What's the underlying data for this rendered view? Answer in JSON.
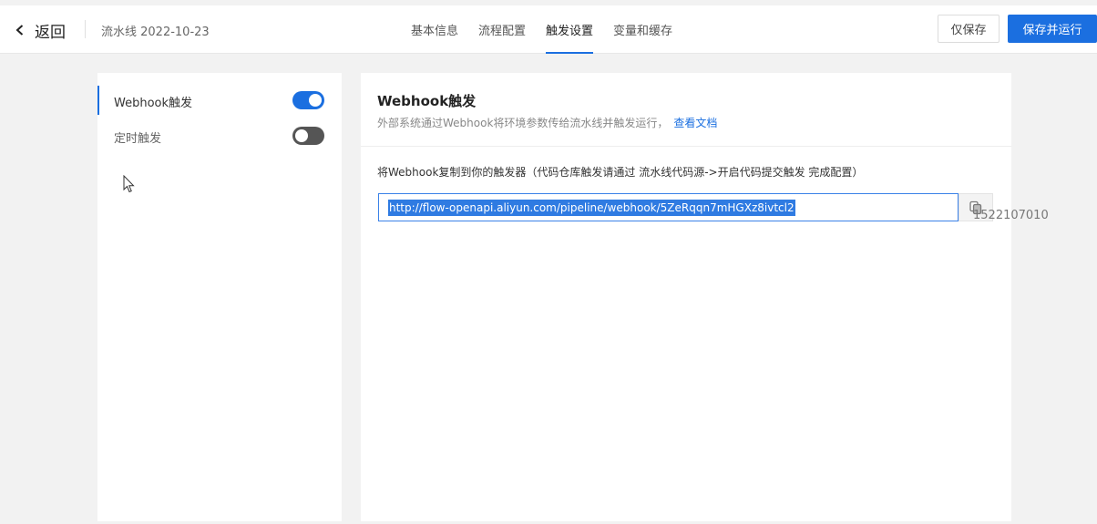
{
  "header": {
    "back_label": "返回",
    "pipeline_name": "流水线 2022-10-23",
    "tabs": [
      {
        "label": "基本信息",
        "active": false
      },
      {
        "label": "流程配置",
        "active": false
      },
      {
        "label": "触发设置",
        "active": true
      },
      {
        "label": "变量和缓存",
        "active": false
      }
    ],
    "save_label": "仅保存",
    "save_run_label": "保存并运行"
  },
  "sidebar": {
    "items": [
      {
        "label": "Webhook触发",
        "enabled": true,
        "active": true
      },
      {
        "label": "定时触发",
        "enabled": false,
        "active": false
      }
    ]
  },
  "webhook": {
    "title": "Webhook触发",
    "description": "外部系统通过Webhook将环境参数传给流水线并触发运行，",
    "doc_link": "查看文档",
    "instruction": "将Webhook复制到你的触发器（代码仓库触发请通过 流水线代码源->开启代码提交触发 完成配置）",
    "url": "http://flow-openapi.aliyun.com/pipeline/webhook/5ZeRqqn7mHGXz8ivtcl2",
    "copy_icon": "copy-icon"
  },
  "overlay": {
    "watermark": "1522107010"
  },
  "colors": {
    "accent": "#1b6fe0",
    "switch_off": "#555555"
  }
}
